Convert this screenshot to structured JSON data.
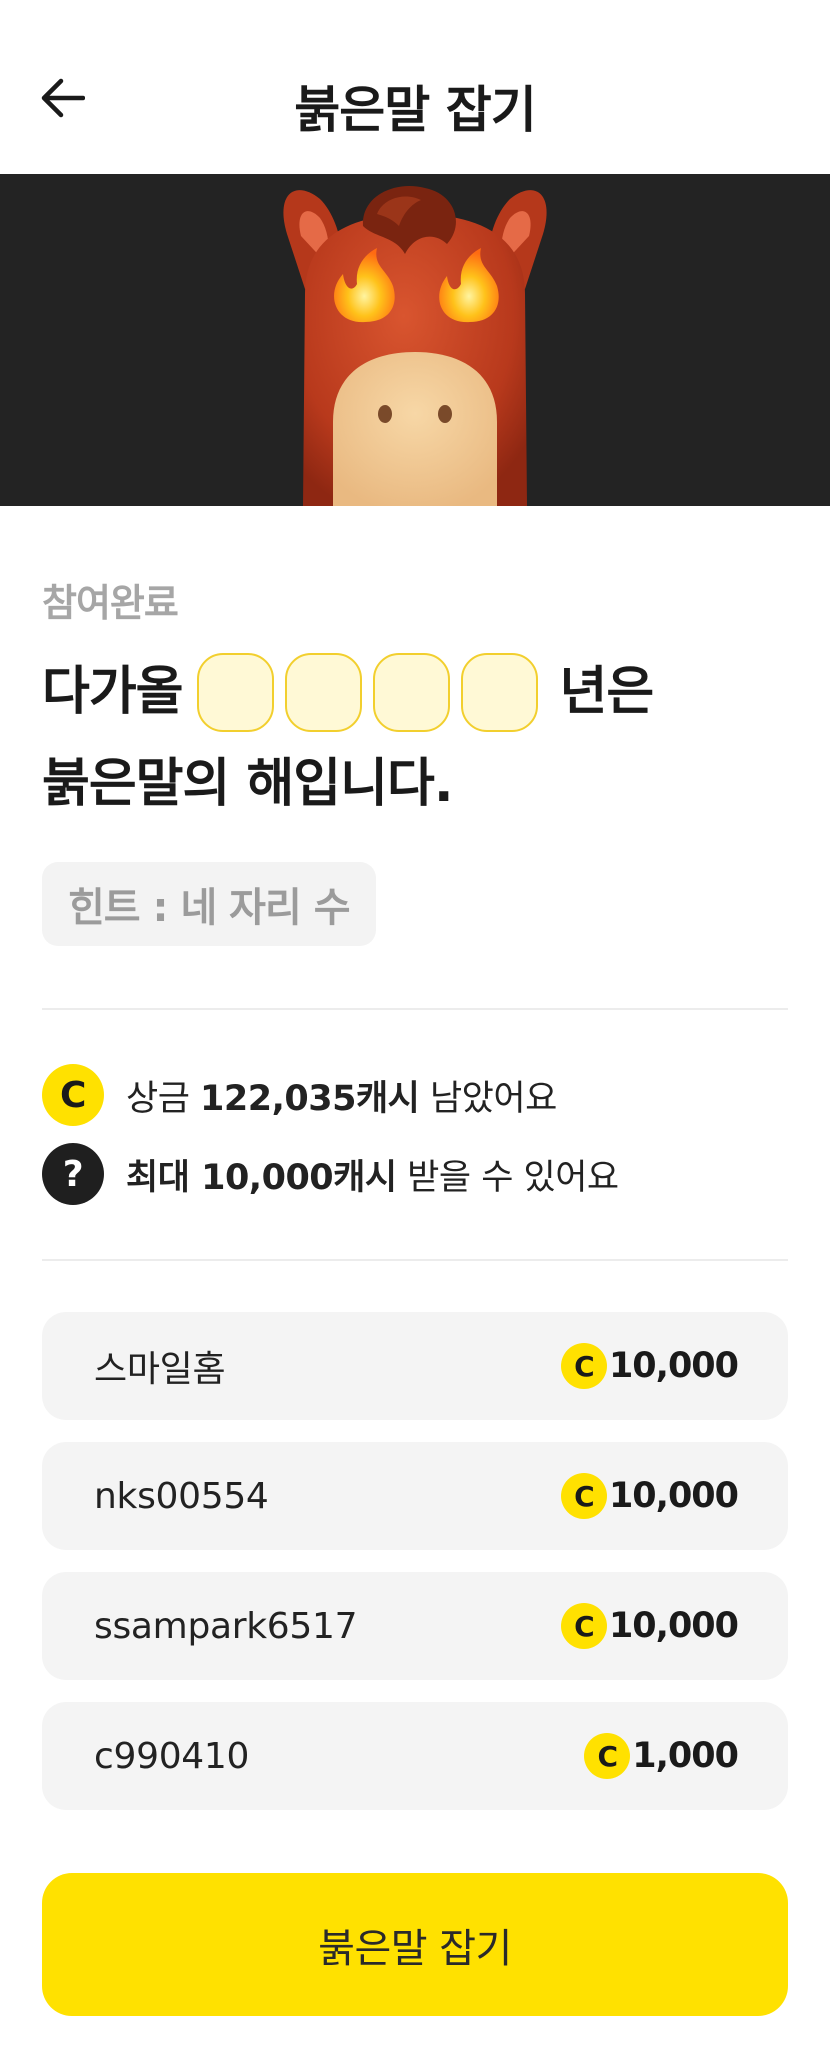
{
  "header": {
    "title": "붉은말 잡기",
    "back_icon": "arrow-left-icon"
  },
  "banner": {
    "background": "#232323",
    "mascot": "red-horse-flame-eyes"
  },
  "status": "참여완료",
  "question": {
    "prefix": "다가올",
    "blank_count": 4,
    "suffix": "년은",
    "line2": "붉은말의 해입니다."
  },
  "hint": "힌트 : 네 자리 수",
  "info": {
    "prize": {
      "icon": "C",
      "pre": "상금 ",
      "amount": "122,035캐시",
      "post": " 남았어요"
    },
    "max": {
      "icon": "?",
      "amount": "최대 10,000캐시",
      "post": " 받을 수 있어요"
    }
  },
  "winners": [
    {
      "name": "스마일홈",
      "coin": "C",
      "amount": "10,000"
    },
    {
      "name": "nks00554",
      "coin": "C",
      "amount": "10,000"
    },
    {
      "name": "ssampark6517",
      "coin": "C",
      "amount": "10,000"
    },
    {
      "name": "c990410",
      "coin": "C",
      "amount": "1,000"
    }
  ],
  "cta_label": "붉은말 잡기",
  "colors": {
    "accent": "#ffe100",
    "blank_border": "#f2cf2e",
    "blank_fill": "#fff9d6",
    "muted": "#a6a6a6"
  }
}
